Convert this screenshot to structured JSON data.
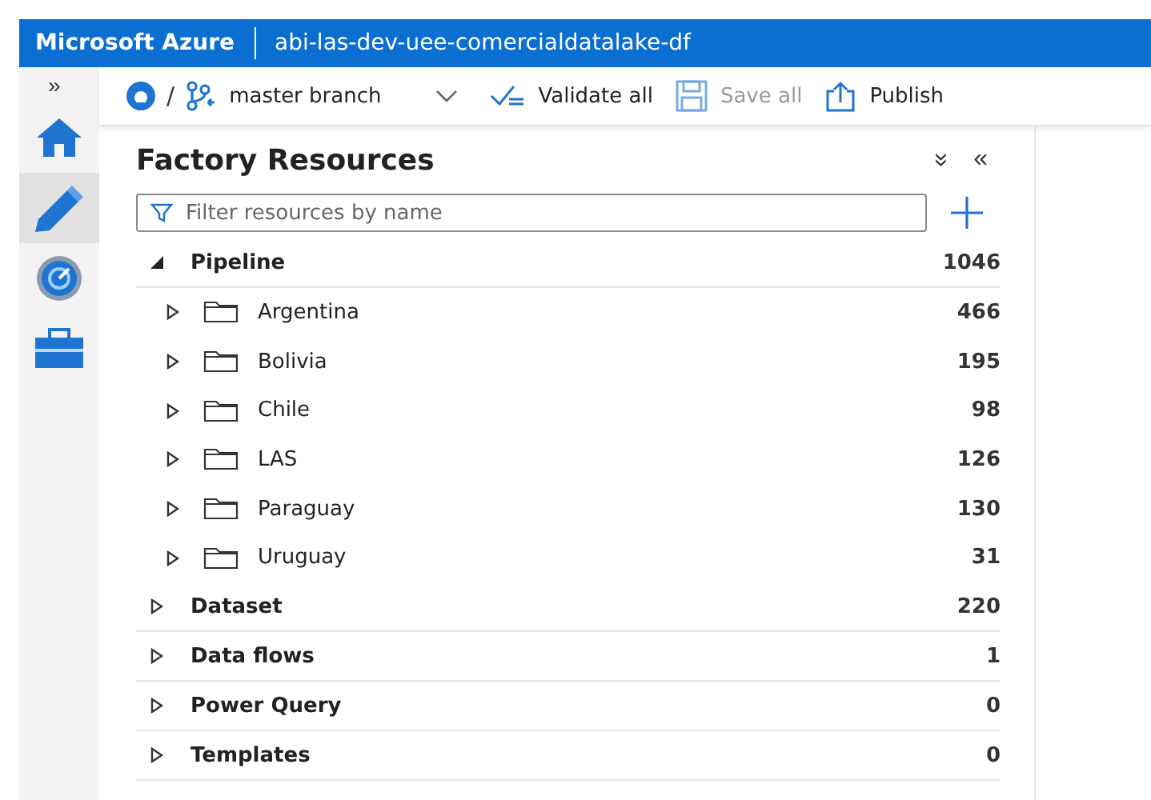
{
  "header": {
    "brand": "Microsoft Azure",
    "resource": "abi-las-dev-uee-comercialdatalake-df"
  },
  "rail": {
    "expand": "»",
    "items": [
      {
        "kind": "home",
        "selected": false
      },
      {
        "kind": "author",
        "selected": true
      },
      {
        "kind": "monitor",
        "selected": false
      },
      {
        "kind": "manage",
        "selected": false
      }
    ]
  },
  "toolbar": {
    "separator": "/",
    "branch": "master branch",
    "actions": [
      {
        "kind": "validate",
        "label": "Validate all",
        "disabled": false
      },
      {
        "kind": "save",
        "label": "Save all",
        "disabled": true
      },
      {
        "kind": "publish",
        "label": "Publish",
        "disabled": false
      }
    ]
  },
  "panel": {
    "title": "Factory Resources",
    "collapse_all": "»",
    "hide": "«",
    "filter": {
      "placeholder": "Filter resources by name"
    },
    "tree": [
      {
        "label": "Pipeline",
        "count": "1046",
        "expanded": true,
        "children": [
          {
            "label": "Argentina",
            "count": "466",
            "expanded": false
          },
          {
            "label": "Bolivia",
            "count": "195",
            "expanded": false
          },
          {
            "label": "Chile",
            "count": "98",
            "expanded": false
          },
          {
            "label": "LAS",
            "count": "126",
            "expanded": false
          },
          {
            "label": "Paraguay",
            "count": "130",
            "expanded": false
          },
          {
            "label": "Uruguay",
            "count": "31",
            "expanded": false
          }
        ]
      },
      {
        "label": "Dataset",
        "count": "220",
        "expanded": false
      },
      {
        "label": "Data flows",
        "count": "1",
        "expanded": false
      },
      {
        "label": "Power Query",
        "count": "0",
        "expanded": false
      },
      {
        "label": "Templates",
        "count": "0",
        "expanded": false
      }
    ]
  }
}
